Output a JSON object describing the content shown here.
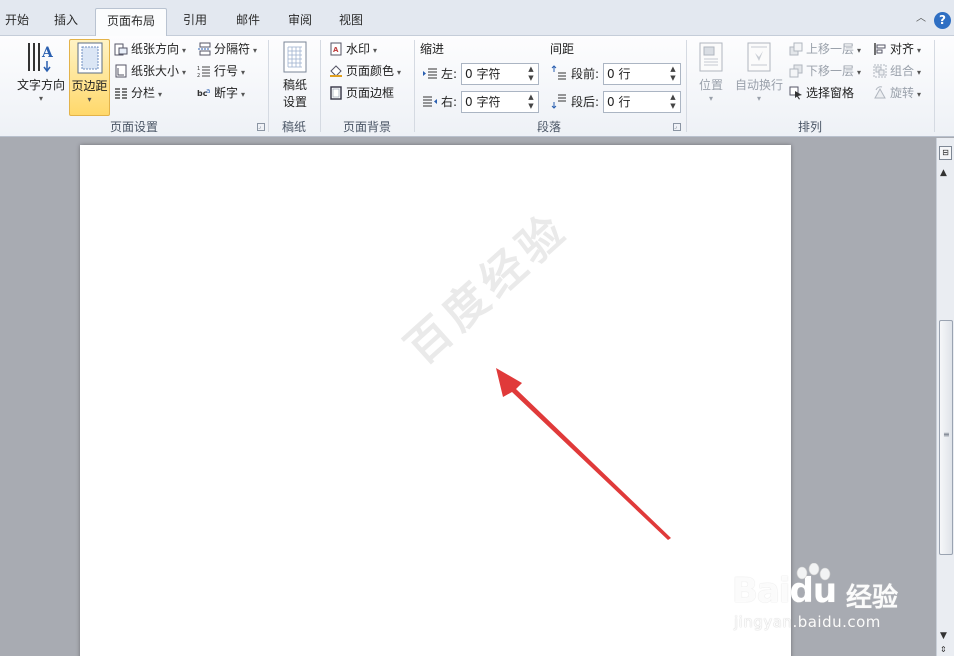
{
  "tabs": [
    {
      "label": "开始",
      "active": false
    },
    {
      "label": "插入",
      "active": false
    },
    {
      "label": "页面布局",
      "active": true
    },
    {
      "label": "引用",
      "active": false
    },
    {
      "label": "邮件",
      "active": false
    },
    {
      "label": "审阅",
      "active": false
    },
    {
      "label": "视图",
      "active": false
    }
  ],
  "page_setup": {
    "text_direction": "文字方向",
    "margins": "页边距",
    "orientation": "纸张方向",
    "size": "纸张大小",
    "columns": "分栏",
    "breaks": "分隔符",
    "line_numbers": "行号",
    "hyphenation": "断字",
    "group_label": "页面设置"
  },
  "manuscript": {
    "button": "稿纸\n设置",
    "button_line1": "稿纸",
    "button_line2": "设置",
    "group_label": "稿纸"
  },
  "page_background": {
    "watermark": "水印",
    "page_color": "页面颜色",
    "page_borders": "页面边框",
    "group_label": "页面背景"
  },
  "paragraph": {
    "indent_title": "缩进",
    "spacing_title": "间距",
    "indent_left_label": "左:",
    "indent_left_value": "0 字符",
    "indent_right_label": "右:",
    "indent_right_value": "0 字符",
    "spacing_before_label": "段前:",
    "spacing_before_value": "0 行",
    "spacing_after_label": "段后:",
    "spacing_after_value": "0 行",
    "group_label": "段落"
  },
  "arrange": {
    "position": "位置",
    "wrap_text": "自动换行",
    "bring_forward": "上移一层",
    "send_backward": "下移一层",
    "selection_pane": "选择窗格",
    "align": "对齐",
    "group": "组合",
    "rotate": "旋转",
    "group_label": "排列"
  },
  "document": {
    "watermark_text": "百度经验"
  },
  "branding": {
    "logo_text_1": "Bai",
    "logo_text_2": "du",
    "logo_text_3": "经验",
    "url": "jingyan.baidu.com"
  },
  "colors": {
    "arrow": "#e03a3a",
    "accent_tab_border": "#b9c3d1",
    "selected_button": "#ffd86b"
  }
}
